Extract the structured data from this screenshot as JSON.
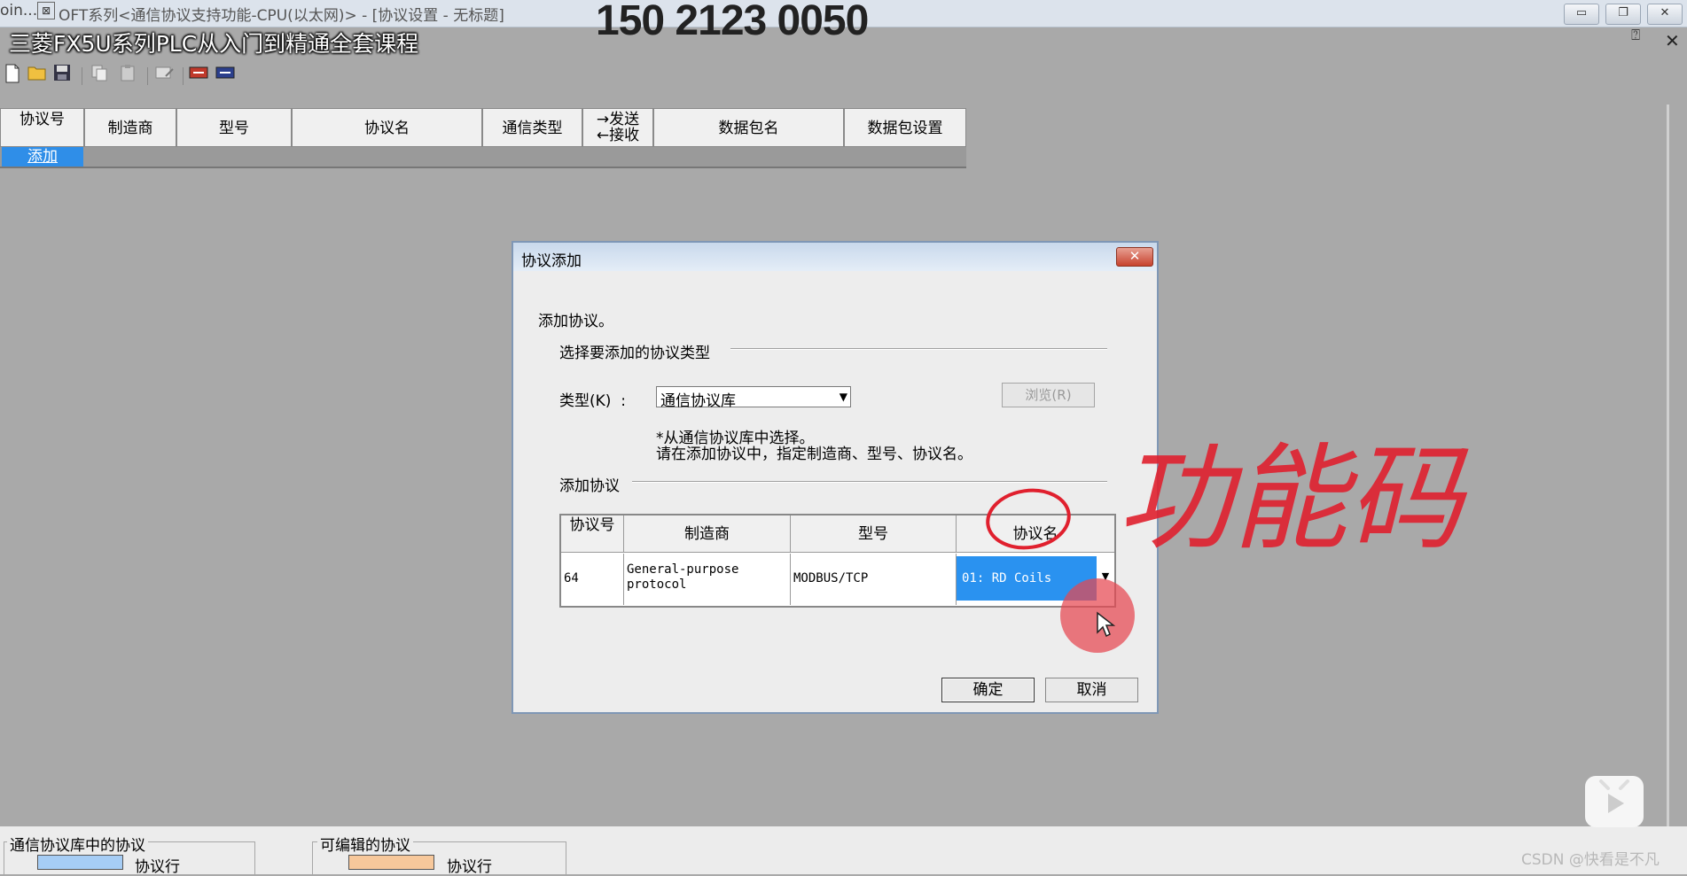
{
  "window": {
    "title_prefix": "oin...",
    "title": "OFT系列<通信协议支持功能-CPU(以太网)> - [协议设置 - 无标题]",
    "min_icon": "minimize-icon",
    "max_icon": "restore-icon",
    "close_icon": "close-icon"
  },
  "overlay": {
    "phone": "150 2123 0050",
    "course_title": "三菱FX5U系列PLC从入门到精通全套课程",
    "handwriting": "功能码",
    "watermark": "CSDN @快看是不凡"
  },
  "toolbar": {
    "icons": [
      "new-file-icon",
      "open-folder-icon",
      "save-icon",
      "copy-icon",
      "paste-icon",
      "edit-icon",
      "read-from-plc-icon",
      "write-to-plc-icon"
    ]
  },
  "grid": {
    "headers": [
      "协议号",
      "制造商",
      "型号",
      "协议名",
      "通信类型",
      "→发送",
      "←接收",
      "数据包名",
      "数据包设置"
    ],
    "add_row_label": "添加"
  },
  "dialog": {
    "title": "协议添加",
    "intro": "添加协议。",
    "section_type": "选择要添加的协议类型",
    "type_label": "类型(K)  :",
    "type_value": "通信协议库",
    "browse_label": "浏览(R)",
    "note_line1": "*从通信协议库中选择。",
    "note_line2": "请在添加协议中，指定制造商、型号、协议名。",
    "section_add": "添加协议",
    "table": {
      "headers": [
        "协议号",
        "制造商",
        "型号",
        "协议名"
      ],
      "row": {
        "number": "64",
        "maker_line1": "General-purpose",
        "maker_line2": "protocol",
        "model": "MODBUS/TCP",
        "name": "01: RD Coils"
      }
    },
    "ok_label": "确定",
    "cancel_label": "取消"
  },
  "legend": {
    "library_title": "通信协议库中的协议",
    "library_item": "协议行",
    "library_color": "#a6cdf5",
    "editable_title": "可编辑的协议",
    "editable_item": "协议行",
    "editable_color": "#f7c89b"
  },
  "colors": {
    "selection": "#2a92f0",
    "annotation_red": "#e0202e"
  }
}
